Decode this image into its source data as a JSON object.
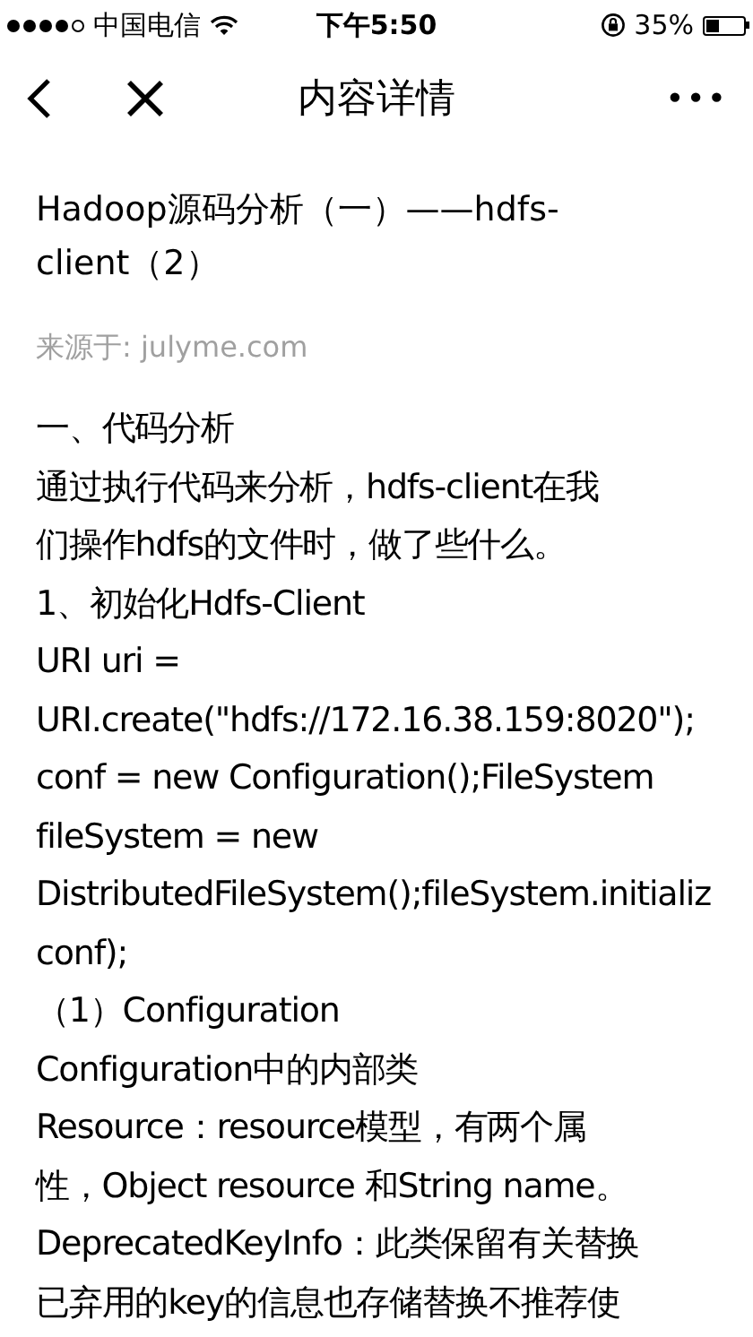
{
  "status_bar": {
    "carrier": "中国电信",
    "time": "下午5:50",
    "battery": "35%"
  },
  "nav_bar": {
    "title": "内容详情",
    "more": "•••"
  },
  "article": {
    "title_lines": [
      "Hadoop源码分析（一）——hdfs-",
      "client（2）"
    ],
    "source": "来源于: julyme.com",
    "lines": [
      "一、代码分析",
      "通过执行代码来分析，hdfs-client在我",
      "们操作hdfs的文件时，做了些什么。",
      "1、初始化Hdfs-Client",
      "URI uri =",
      "URI.create(\"hdfs://172.16.38.159:8020\");",
      "conf = new Configuration();FileSystem",
      "fileSystem = new",
      "DistributedFileSystem();fileSystem.initializ",
      "conf);",
      "（1）Configuration",
      "Configuration中的内部类",
      "Resource：resource模型，有两个属",
      "性，Object resource 和String name。",
      "DeprecatedKeyInfo：此类保留有关替换",
      "已弃用的key的信息也存储替换不推荐使"
    ]
  }
}
